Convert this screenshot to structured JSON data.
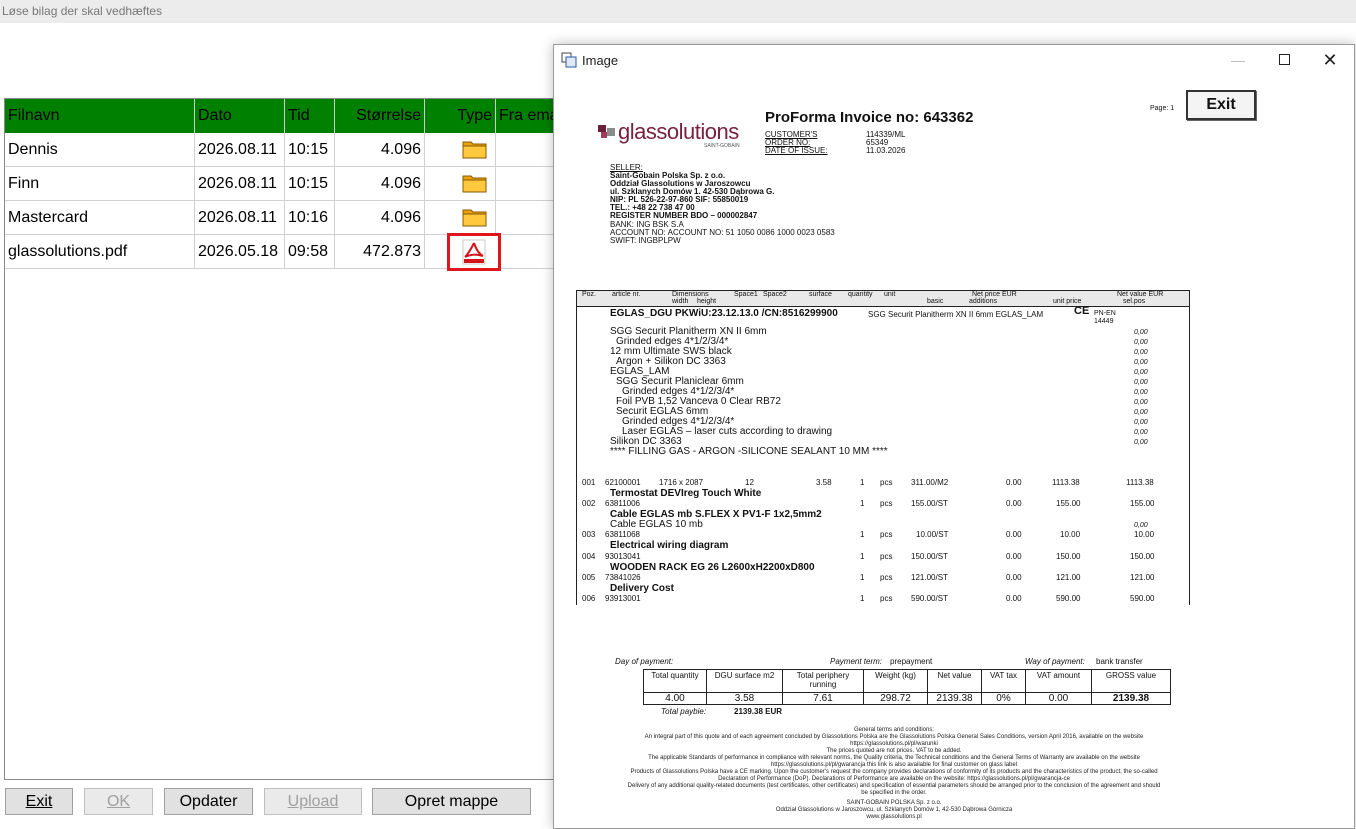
{
  "window": {
    "title": "Løse bilag der skal vedhæftes"
  },
  "grid": {
    "columns": [
      "Filnavn",
      "Dato",
      "Tid",
      "Størrelse",
      "Type",
      "Fra ema"
    ],
    "rows": [
      {
        "filename": "Dennis",
        "date": "2026.08.11",
        "time": "10:15",
        "size": "4.096",
        "type": "folder"
      },
      {
        "filename": "Finn",
        "date": "2026.08.11",
        "time": "10:15",
        "size": "4.096",
        "type": "folder"
      },
      {
        "filename": "Mastercard",
        "date": "2026.08.11",
        "time": "10:16",
        "size": "4.096",
        "type": "folder"
      },
      {
        "filename": "glassolutions.pdf",
        "date": "2026.05.18",
        "time": "09:58",
        "size": "472.873",
        "type": "pdf"
      }
    ]
  },
  "buttons": {
    "exit": "Exit",
    "ok": "OK",
    "update": "Opdater",
    "upload": "Upload",
    "create_folder": "Opret mappe"
  },
  "image_window": {
    "title": "Image",
    "exit_label": "Exit",
    "doc": {
      "page": "Page: 1",
      "title": "ProForma Invoice no: 643362",
      "logo": "glassolutions",
      "logo_sub": "SAINT-GOBAIN",
      "meta_labels": [
        "CUSTOMER'S",
        "ORDER NO:",
        "DATE OF ISSUE:"
      ],
      "meta_values": [
        "114339/ML",
        "65349",
        "11.03.2026"
      ],
      "seller_lines": [
        "SELLER:",
        "Saint-Gobain Polska Sp. z o.o.",
        "Oddział Glassolutions w Jaroszowcu",
        "ul. Szklanych Domów 1. 42-530 Dąbrowa G.",
        "NIP: PL 526-22-97-860          SIF: 55850019",
        "TEL.: +48 22 738 47 00",
        "REGISTER NUMBER BDO – 000002847",
        "BANK: ING BSK S.A",
        "ACCOUNT NO: ACCOUNT NO: 51 1050 0086 1000 0023 0583",
        "SWIFT: INGBPLPW"
      ],
      "table_head1": [
        "Poz.",
        "article nr.",
        "Dimensions",
        "Space1",
        "Space2",
        "surface",
        "quantity",
        "unit",
        "Net price EUR",
        "Net value EUR"
      ],
      "table_head2": [
        "width",
        "height",
        "basic",
        "additions",
        "unit price",
        "sel.pos"
      ],
      "product_line": "EGLAS_DGU PKWiU:23.12.13.0 /CN:8516299900",
      "product_desc": "SGG Securit Planitherm XN II 6mm EGLAS_LAM",
      "ce_mark": "CE",
      "pn": "PN-EN 14449",
      "components": [
        "SGG Securit Planitherm XN II 6mm",
        " Grinded edges 4*1/2/3/4*",
        "12 mm Ultimate SWS black",
        " Argon + Silikon DC 3363",
        "EGLAS_LAM",
        " SGG Securit Planiclear 6mm",
        "  Grinded edges 4*1/2/3/4*",
        " Foil PVB 1,52 Vanceva 0 Clear RB72",
        " Securit EGLAS 6mm",
        "  Grinded edges 4*1/2/3/4*",
        "  Laser EGLAS – laser cuts according to drawing",
        "Silikon DC 3363",
        "**** FILLING GAS - ARGON -SILICONE SEALANT 10 MM ****"
      ],
      "zero": "0,00",
      "items": [
        {
          "pos": "001",
          "art": "62100001",
          "dims": "1716  x  2087",
          "s1": "12",
          "surface": "3.58",
          "qty": "1",
          "unit": "pcs",
          "price": "311.00/M2",
          "add": "0.00",
          "unitprice": "1113.38",
          "value": "1113.38",
          "label": "Termostat DEVIreg Touch White"
        },
        {
          "pos": "002",
          "art": "63811006",
          "dims": "",
          "s1": "",
          "surface": "",
          "qty": "1",
          "unit": "pcs",
          "price": "155.00/ST",
          "add": "0.00",
          "unitprice": "155.00",
          "value": "155.00",
          "label": "Cable EGLAS mb S.FLEX X PV1-F 1x2,5mm2"
        },
        {
          "pos": "003",
          "art": "63811068",
          "dims": "",
          "s1": "",
          "surface": "",
          "qty": "1",
          "unit": "pcs",
          "price": "10.00/ST",
          "add": "0.00",
          "unitprice": "10.00",
          "value": "10.00",
          "label": "Electrical wiring diagram"
        },
        {
          "pos": "004",
          "art": "93013041",
          "dims": "",
          "s1": "",
          "surface": "",
          "qty": "1",
          "unit": "pcs",
          "price": "150.00/ST",
          "add": "0.00",
          "unitprice": "150.00",
          "value": "150.00",
          "label": "WOODEN RACK EG 26  L2600xH2200xD800"
        },
        {
          "pos": "005",
          "art": "73841026",
          "dims": "",
          "s1": "",
          "surface": "",
          "qty": "1",
          "unit": "pcs",
          "price": "121.00/ST",
          "add": "0.00",
          "unitprice": "121.00",
          "value": "121.00",
          "label": "Delivery Cost"
        },
        {
          "pos": "006",
          "art": "93913001",
          "dims": "",
          "s1": "",
          "surface": "",
          "qty": "1",
          "unit": "pcs",
          "price": "590.00/ST",
          "add": "0.00",
          "unitprice": "590.00",
          "value": "590.00",
          "label": ""
        }
      ],
      "cable_sub": "Cable EGLAS 10 mb",
      "payment": {
        "day_label": "Day of payment:",
        "term_label": "Payment term:",
        "term": "prepayment",
        "way_label": "Way of payment:",
        "way": "bank transfer"
      },
      "summary_heads": [
        "Total quantity",
        "DGU surface m2",
        "Total periphery running",
        "Weight (kg)",
        "Net value",
        "VAT tax",
        "VAT amount",
        "GROSS value"
      ],
      "summary_values": [
        "4.00",
        "3.58",
        "7.61",
        "298.72",
        "2139.38",
        "0%",
        "0.00",
        "2139.38"
      ],
      "total_label": "Total paybie:",
      "total_value": "2139.38 EUR",
      "terms": [
        "General terms and conditions:",
        "An integral part of this quote and of each agreement concluded by   Glassolutions Polska are the Glassolutions Polska General Sales Conditions, version April 2016, available on the website",
        "https://glassolutions.pl/pl/warunki",
        "The prices quoted are not prices. VAT to be added.",
        "The applicable Standards of performance in compliance with relevant norms, the Quality criteria, the Technical conditions and the General Terms of Warranty are available on the website",
        "https://glassolutions.pl/pl/gwarancja this link is also available for final customer on glass label",
        "Products of Glassolutions Polska have a CE marking. Upon the customer's request the company provides declarations of conformity of its products and the characteristics of the product, the so-called",
        "Declaration of Performance (DoP). Declarations of Performance are available on the website: https://glassolutions.pl/pl/gwarancja-ce",
        "Delivery of any additional quality-related documents (test certificates, other certificates) and specification of essential parameters should be arranged prior to the conclusion of the agreement and should",
        "be specified in the order.",
        "SAINT-GOBAIN POLSKA Sp. z o.o.",
        "Oddział Glassolutions w Jaroszowcu, ul. Szklanych Domów 1, 42-530 Dąbrowa Górnicza",
        "www.glassolutions.pl"
      ]
    }
  }
}
